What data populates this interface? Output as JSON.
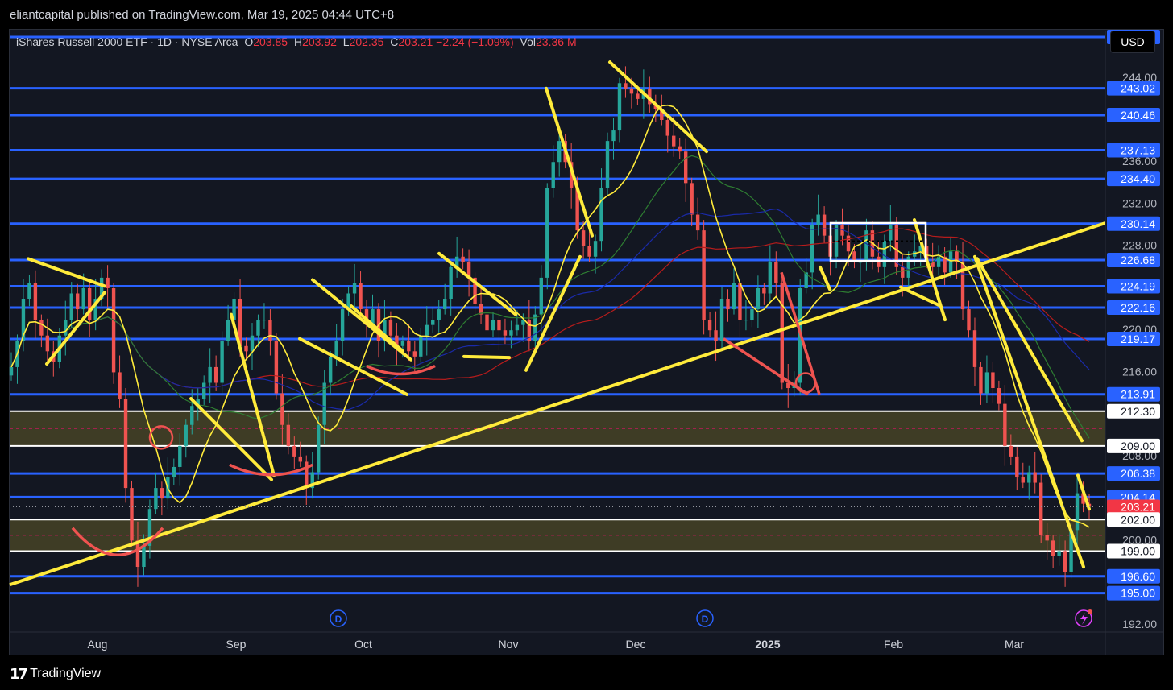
{
  "header": {
    "publisher_line": "eliantcapital published on TradingView.com, Mar 19, 2025 04:44 UTC+8"
  },
  "legend": {
    "symbol": "iShares Russell 2000 ETF · 1D · NYSE Arca",
    "open_label": "O",
    "open": "203.85",
    "high_label": "H",
    "high": "203.92",
    "low_label": "L",
    "low": "202.35",
    "close_label": "C",
    "close": "203.21",
    "change": "−2.24 (−1.09%)",
    "vol_label": "Vol",
    "vol": "23.36 M"
  },
  "currency_button": "USD",
  "footer": {
    "logo": "17",
    "brand": "TradingView"
  },
  "colors": {
    "background": "#131722",
    "up": "#26a69a",
    "down": "#ef5350",
    "level_line": "#2962ff",
    "trend": "#ffeb3b",
    "ma_green": "#2e7d32",
    "ma_blue": "#1a2aa8",
    "ma_red": "#b71c1c",
    "zone_fill": "#4d4a27",
    "last_price": "#f23645"
  },
  "chart_data": {
    "type": "candlestick",
    "title": "iShares Russell 2000 ETF · 1D · NYSE Arca",
    "currency": "USD",
    "ylim": [
      191.3,
      248.5
    ],
    "price_scale_ticks": [
      "244.00",
      "236.00",
      "232.00",
      "228.00",
      "220.00",
      "216.00",
      "208.00",
      "200.00",
      "192.00"
    ],
    "x_ticks": [
      "Aug",
      "Sep",
      "Oct",
      "Nov",
      "Dec",
      "2025",
      "Feb",
      "Mar"
    ],
    "horizontal_levels": [
      247.89,
      243.02,
      240.46,
      237.13,
      234.4,
      230.14,
      226.68,
      224.19,
      222.16,
      219.17,
      213.91,
      206.38,
      204.14,
      196.6,
      195.0
    ],
    "white_levels": [
      212.3,
      209.0,
      202.0,
      199.0
    ],
    "zones": [
      {
        "top": 212.3,
        "bottom": 209.0
      },
      {
        "top": 202.0,
        "bottom": 199.0
      }
    ],
    "level_labels": [
      "247.89",
      "243.02",
      "240.46",
      "237.13",
      "234.40",
      "230.14",
      "226.68",
      "224.19",
      "222.16",
      "219.17",
      "213.91",
      "212.30",
      "209.00",
      "206.38",
      "204.14",
      "203.21",
      "202.00",
      "199.00",
      "196.60",
      "195.00"
    ],
    "last_price": 203.21,
    "dividend_markers": [
      "D",
      "D"
    ],
    "close_series": [
      216.5,
      219,
      223,
      224.5,
      221,
      219.5,
      218,
      217,
      219.5,
      221,
      223.5,
      222,
      224,
      221,
      223,
      225,
      224,
      216,
      213.5,
      205,
      200,
      197.5,
      199.5,
      203,
      205,
      204,
      206,
      207,
      209,
      211,
      212.8,
      213.5,
      215,
      216.5,
      215,
      219,
      221,
      223,
      218.5,
      218,
      219.5,
      221,
      221,
      219,
      214,
      211,
      209,
      208,
      207.5,
      205,
      206.5,
      211,
      215,
      217.5,
      219,
      222,
      223.5,
      224.5,
      222,
      220.5,
      222,
      219,
      221,
      219.5,
      218.5,
      219,
      218,
      217.5,
      219.5,
      220.5,
      221,
      222,
      223,
      226,
      227,
      226.5,
      225,
      222.5,
      221.5,
      220,
      221,
      220,
      219.5,
      220,
      220.5,
      221,
      219,
      221.5,
      225,
      233.5,
      236,
      238,
      236,
      233.5,
      229.5,
      228,
      227,
      228.5,
      233.5,
      238,
      239,
      243.5,
      243,
      242.5,
      242,
      243,
      241.5,
      241,
      240,
      238.5,
      237.5,
      237,
      234,
      231,
      229.5,
      221,
      220,
      219,
      223,
      222,
      224.5,
      221,
      221,
      222,
      224,
      223.5,
      226.5,
      224.5,
      215,
      214.5,
      215,
      224,
      225.5,
      230,
      231,
      229,
      227,
      230,
      229,
      227.5,
      226.5,
      226.5,
      229.5,
      227,
      226,
      228.5,
      230,
      226,
      225,
      227,
      227.5,
      228,
      226.5,
      226,
      227,
      225.5,
      227.5,
      226.5,
      222,
      220,
      216.5,
      214,
      216,
      214.5,
      213,
      209,
      208,
      206,
      205.5,
      206.5,
      205.5,
      200.5,
      200,
      198.5,
      199,
      197,
      201,
      204.5,
      203.5,
      203.21
    ],
    "annotations": [
      "yellow trend lines",
      "yellow triangle/wedge patterns",
      "red cup patterns",
      "long ascending yellow trendline",
      "red circles at pivot lows",
      "white consolidation box"
    ]
  }
}
